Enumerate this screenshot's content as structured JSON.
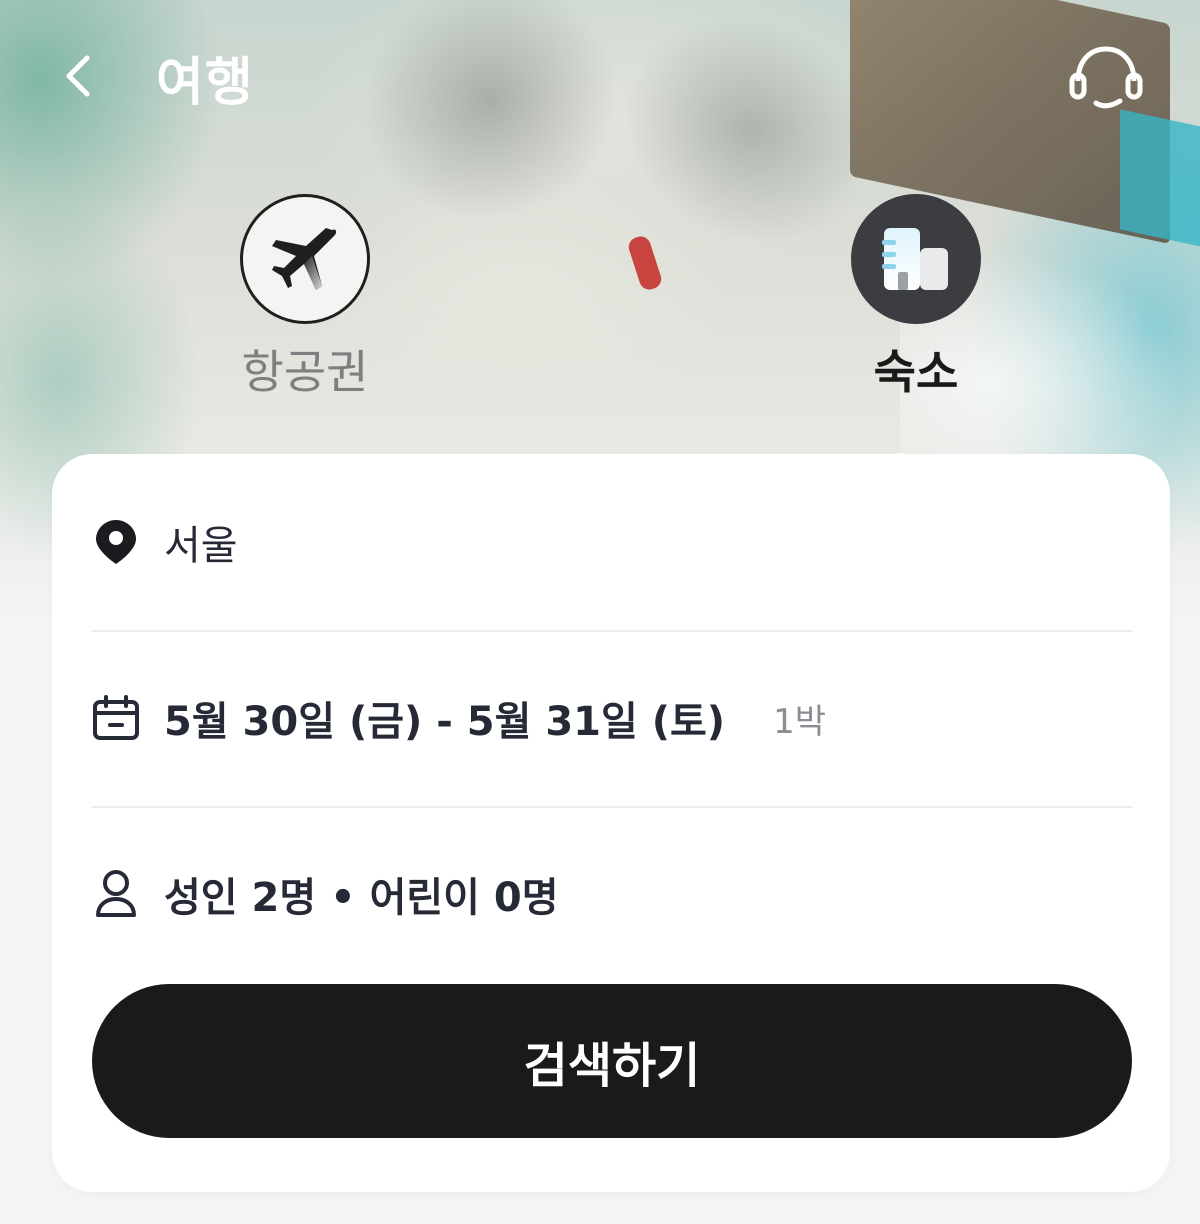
{
  "header": {
    "title": "여행"
  },
  "tabs": [
    {
      "label": "항공권",
      "icon": "airplane-icon",
      "selected": false
    },
    {
      "label": "숙소",
      "icon": "building-icon",
      "selected": true
    }
  ],
  "form": {
    "location": "서울",
    "dates": "5월 30일 (금) - 5월 31일 (토)",
    "nights": "1박",
    "guests": "성인 2명 • 어린이 0명",
    "search_label": "검색하기"
  },
  "colors": {
    "primary_button": "#1a1a1a",
    "text_main": "#262a36",
    "text_muted": "#8a8d93",
    "hotel_tab_bg": "#3b3d40"
  }
}
